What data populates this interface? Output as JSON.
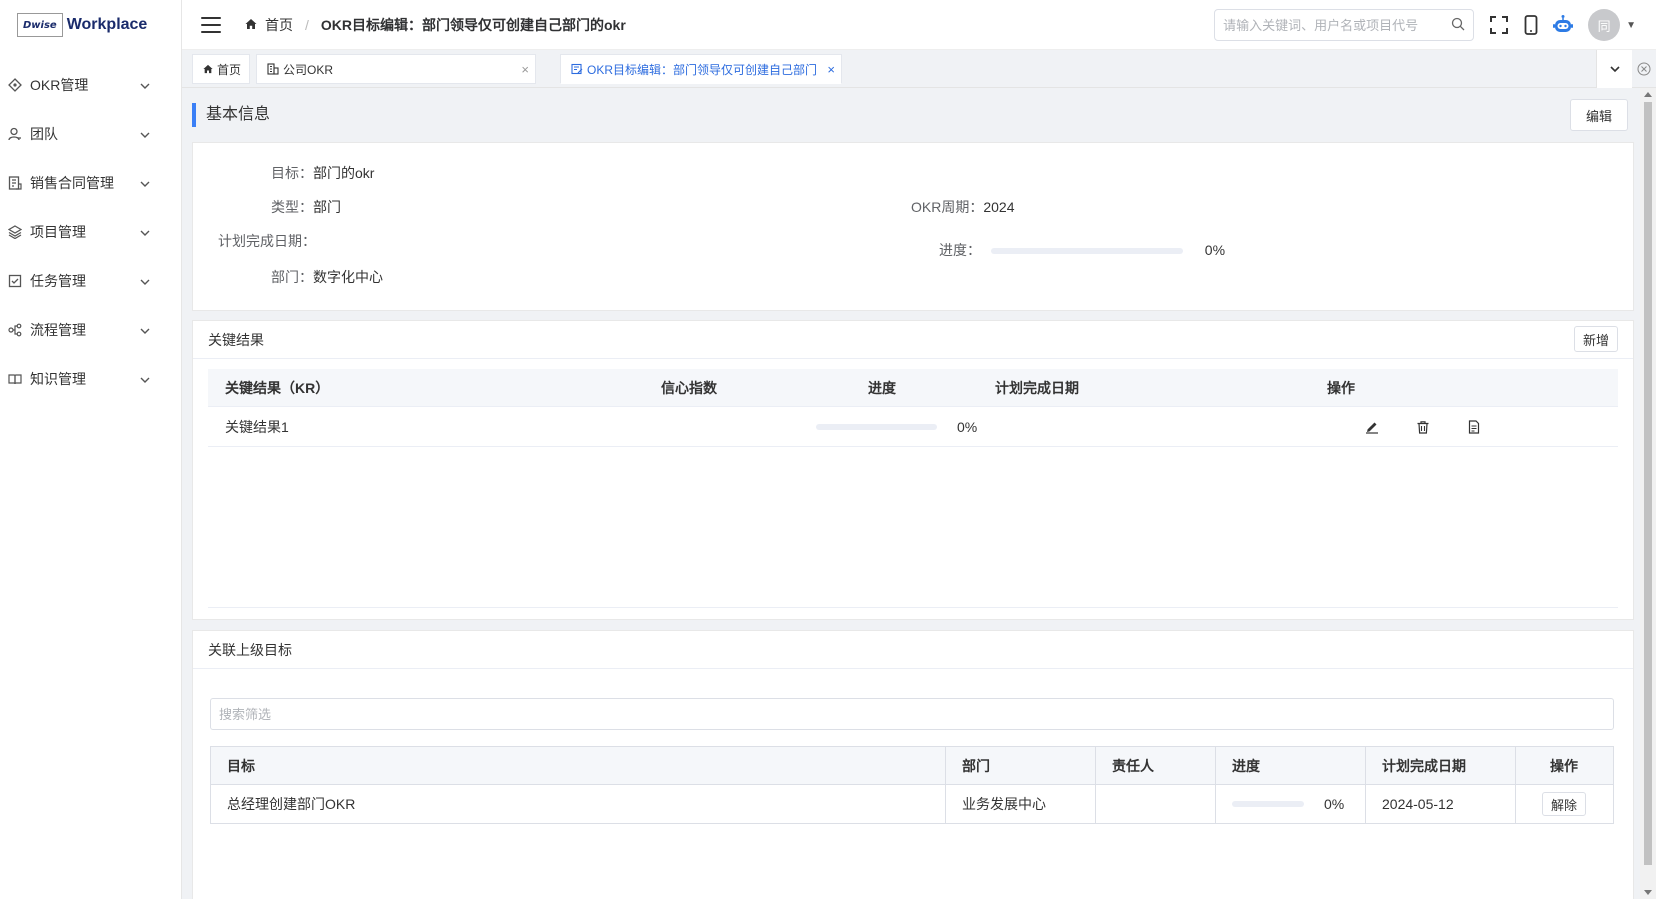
{
  "app": {
    "logo_badge": "Dwise",
    "logo_text": "Workplace"
  },
  "sidebar": {
    "items": [
      {
        "label": "OKR管理",
        "icon": "okr-icon"
      },
      {
        "label": "团队",
        "icon": "team-icon"
      },
      {
        "label": "销售合同管理",
        "icon": "contract-icon"
      },
      {
        "label": "项目管理",
        "icon": "layers-icon"
      },
      {
        "label": "任务管理",
        "icon": "task-icon"
      },
      {
        "label": "流程管理",
        "icon": "flow-icon"
      },
      {
        "label": "知识管理",
        "icon": "book-icon"
      }
    ]
  },
  "header": {
    "breadcrumb_home": "首页",
    "breadcrumb_separator": "/",
    "breadcrumb_current": "OKR目标编辑：部门领导仅可创建自己部门的okr",
    "search_placeholder": "请输入关键词、用户名或项目代号",
    "avatar_text": "同"
  },
  "tabs": [
    {
      "label": "首页",
      "icon": "home-icon"
    },
    {
      "label": "公司OKR",
      "icon": "building-icon"
    },
    {
      "label": "OKR目标编辑：部门领导仅可创建自己部门的okr",
      "icon": "edit-doc-icon",
      "active": true
    }
  ],
  "basic_info": {
    "section_title": "基本信息",
    "edit_label": "编辑",
    "goal_label": "目标：",
    "goal_value": "部门的okr",
    "type_label": "类型：",
    "type_value": "部门",
    "period_label": "OKR周期：",
    "period_value": "2024",
    "plan_date_label": "计划完成日期：",
    "plan_date_value": "",
    "progress_label": "进度：",
    "progress_text": "0%",
    "progress_value": 0,
    "dept_label": "部门：",
    "dept_value": "数字化中心"
  },
  "key_results": {
    "title": "关键结果",
    "add_label": "新增",
    "columns": [
      "关键结果（KR）",
      "信心指数",
      "进度",
      "计划完成日期",
      "操作"
    ],
    "rows": [
      {
        "name": "关键结果1",
        "confidence": "",
        "progress_text": "0%",
        "progress_value": 0,
        "plan_date": ""
      }
    ]
  },
  "parent_goals": {
    "title": "关联上级目标",
    "filter_placeholder": "搜索筛选",
    "columns": [
      "目标",
      "部门",
      "责任人",
      "进度",
      "计划完成日期",
      "操作"
    ],
    "rows": [
      {
        "goal": "总经理创建部门OKR",
        "dept": "业务发展中心",
        "owner": "",
        "progress_text": "0%",
        "progress_value": 0,
        "plan_date": "2024-05-12",
        "action": "解除"
      }
    ]
  },
  "colors": {
    "accent": "#3a7ff6",
    "active_tab": "#2d6cdf"
  }
}
